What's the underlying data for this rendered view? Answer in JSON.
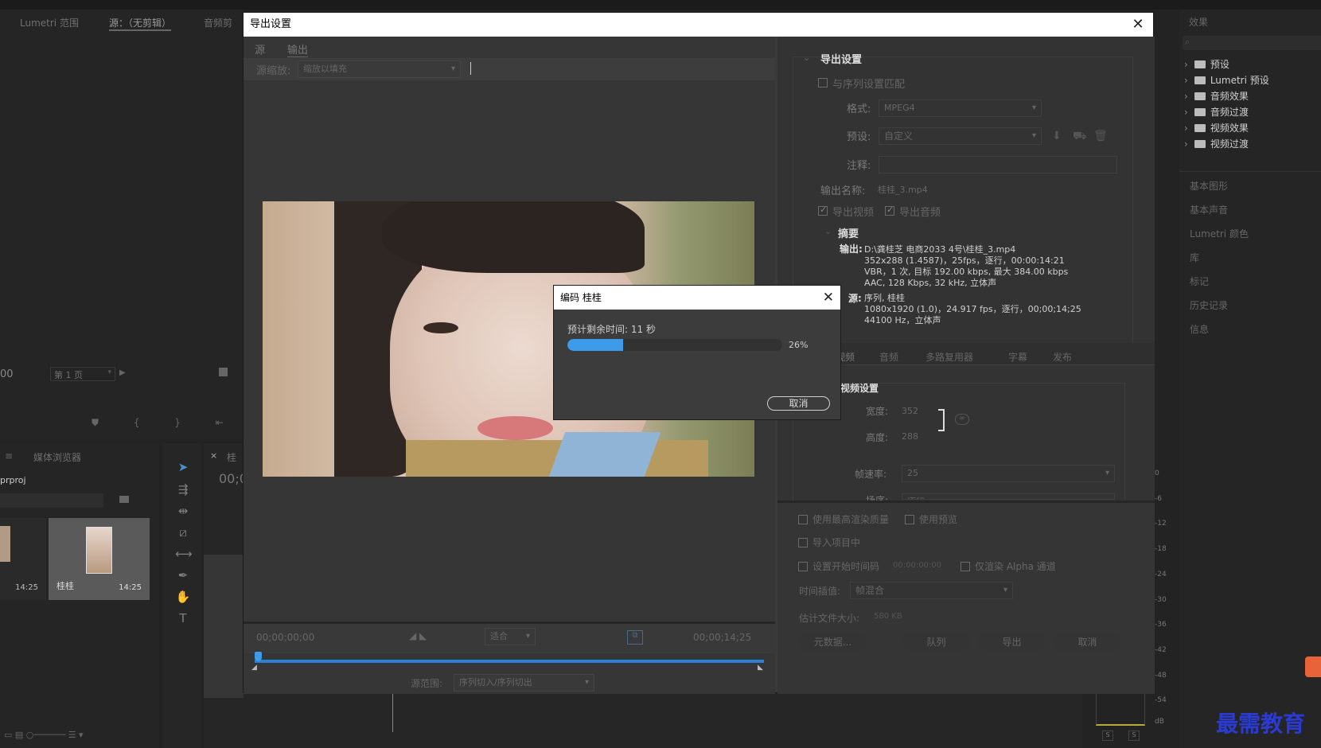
{
  "background": {
    "top_tabs": [
      "Lumetri 范围",
      "源：（无剪辑）",
      "音频剪"
    ],
    "page_label": "第 1 页",
    "left_timecode": "00",
    "media_browser_label": "媒体浏览器",
    "project_file_fragment": "prproj",
    "thumb1_duration": "14:25",
    "thumb2_name": "桂桂",
    "thumb2_duration": "14:25",
    "seq_tab_fragment": "桂",
    "seq_timecode_fragment": "00;0",
    "meter_labels": [
      "0",
      "-6",
      "-12",
      "-18",
      "-24",
      "-30",
      "-36",
      "-42",
      "-48",
      "-54",
      "dB"
    ],
    "meter_solo": [
      "S",
      "S"
    ],
    "watermark": "最需教育"
  },
  "effects_panel": {
    "title": "效果",
    "items": [
      "预设",
      "Lumetri 预设",
      "音频效果",
      "音频过渡",
      "视频效果",
      "视频过渡"
    ],
    "sections": [
      "基本图形",
      "基本声音",
      "Lumetri 颜色",
      "库",
      "标记",
      "历史记录",
      "信息"
    ]
  },
  "export_dialog": {
    "title": "导出设置",
    "tabs": [
      "源",
      "输出"
    ],
    "scale_label": "源缩放:",
    "scale_value": "缩放以填充",
    "timecode_start": "00;00;00;00",
    "timecode_end": "00;00;14;25",
    "fit_value": "适合",
    "range_label": "源范围:",
    "range_value": "序列切入/序列切出",
    "settings": {
      "section_title": "导出设置",
      "match_sequence": "与序列设置匹配",
      "format_label": "格式:",
      "format_value": "MPEG4",
      "preset_label": "预设:",
      "preset_value": "自定义",
      "comment_label": "注释:",
      "output_name_label": "输出名称:",
      "output_name_value": "桂桂_3.mp4",
      "export_video": "导出视频",
      "export_audio": "导出音频",
      "summary_title": "摘要",
      "output_label": "输出:",
      "output_lines": [
        "D:\\龚桂芝 电商2033 4号\\桂桂_3.mp4",
        "352x288 (1.4587)，25fps，逐行，00:00:14:21",
        "VBR，1 次, 目标 192.00 kbps, 最大 384.00 kbps",
        "AAC, 128 Kbps, 32  kHz, 立体声"
      ],
      "source_label": "源:",
      "source_lines": [
        "序列, 桂桂",
        "1080x1920 (1.0)，24.917  fps，逐行，00;00;14;25",
        "44100 Hz，立体声"
      ]
    },
    "sub_tabs": [
      "视频",
      "音频",
      "多路复用器",
      "字幕",
      "发布"
    ],
    "video_settings": {
      "title": "视频设置",
      "width_label": "宽度:",
      "width_value": "352",
      "height_label": "高度:",
      "height_value": "288",
      "fps_label": "帧速率:",
      "fps_value": "25",
      "field_label": "场序:",
      "field_value": "逐行"
    },
    "bottom": {
      "max_render": "使用最高渲染质量",
      "use_preview": "使用预览",
      "import_project": "导入项目中",
      "set_start_tc": "设置开始时间码",
      "start_tc_value": "00:00:00:00",
      "alpha_only": "仅渲染 Alpha 通道",
      "interp_label": "时间插值:",
      "interp_value": "帧混合",
      "filesize_label": "估计文件大小:",
      "filesize_value": "580 KB",
      "buttons": [
        "元数据...",
        "队列",
        "导出",
        "取消"
      ]
    }
  },
  "progress_dialog": {
    "title": "编码 桂桂",
    "remaining": "预计剩余时间: 11 秒",
    "percent_text": "26%",
    "progress": 0.26,
    "cancel": "取消",
    "accent": "#3d9be9"
  }
}
